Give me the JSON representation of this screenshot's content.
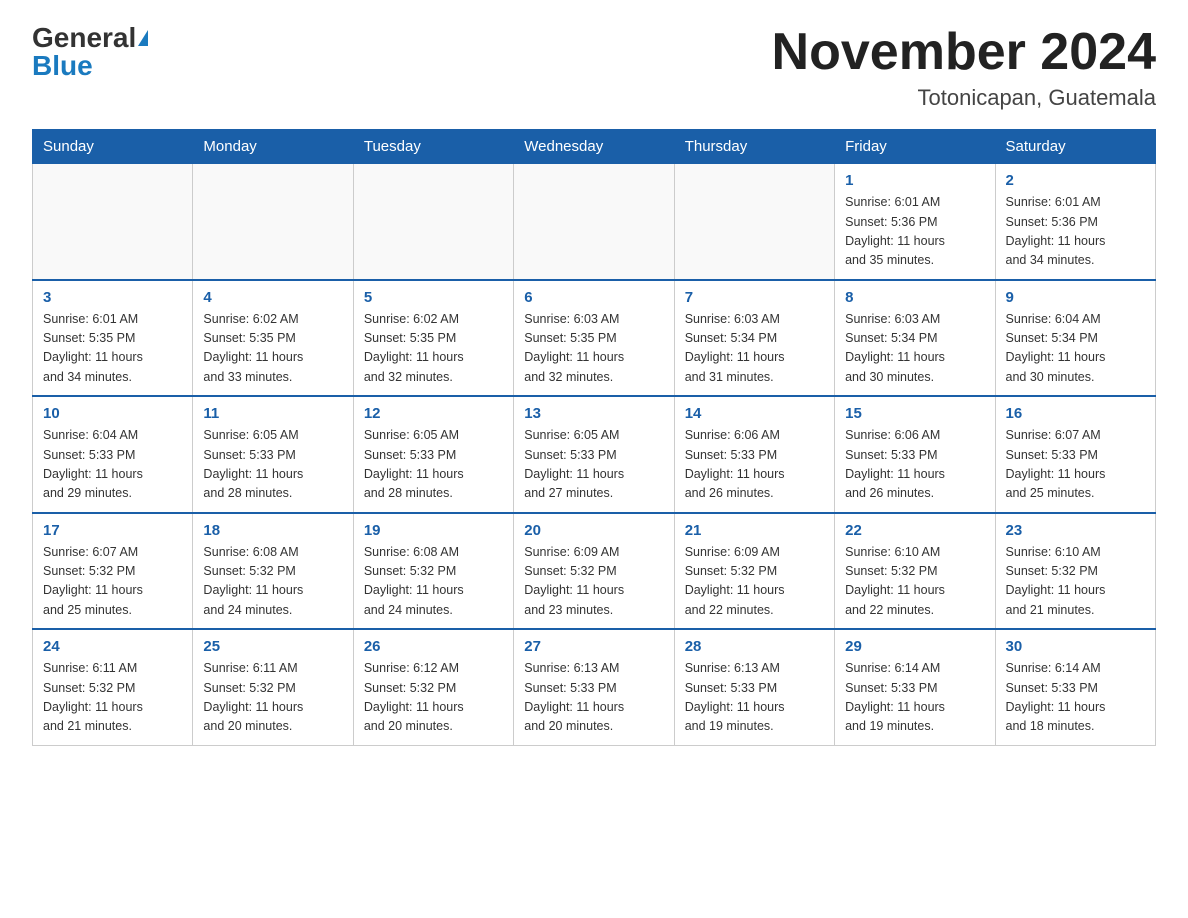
{
  "header": {
    "logo_general": "General",
    "logo_blue": "Blue",
    "month_title": "November 2024",
    "location": "Totonicapan, Guatemala"
  },
  "days_of_week": [
    "Sunday",
    "Monday",
    "Tuesday",
    "Wednesday",
    "Thursday",
    "Friday",
    "Saturday"
  ],
  "weeks": [
    [
      {
        "day": "",
        "info": ""
      },
      {
        "day": "",
        "info": ""
      },
      {
        "day": "",
        "info": ""
      },
      {
        "day": "",
        "info": ""
      },
      {
        "day": "",
        "info": ""
      },
      {
        "day": "1",
        "info": "Sunrise: 6:01 AM\nSunset: 5:36 PM\nDaylight: 11 hours\nand 35 minutes."
      },
      {
        "day": "2",
        "info": "Sunrise: 6:01 AM\nSunset: 5:36 PM\nDaylight: 11 hours\nand 34 minutes."
      }
    ],
    [
      {
        "day": "3",
        "info": "Sunrise: 6:01 AM\nSunset: 5:35 PM\nDaylight: 11 hours\nand 34 minutes."
      },
      {
        "day": "4",
        "info": "Sunrise: 6:02 AM\nSunset: 5:35 PM\nDaylight: 11 hours\nand 33 minutes."
      },
      {
        "day": "5",
        "info": "Sunrise: 6:02 AM\nSunset: 5:35 PM\nDaylight: 11 hours\nand 32 minutes."
      },
      {
        "day": "6",
        "info": "Sunrise: 6:03 AM\nSunset: 5:35 PM\nDaylight: 11 hours\nand 32 minutes."
      },
      {
        "day": "7",
        "info": "Sunrise: 6:03 AM\nSunset: 5:34 PM\nDaylight: 11 hours\nand 31 minutes."
      },
      {
        "day": "8",
        "info": "Sunrise: 6:03 AM\nSunset: 5:34 PM\nDaylight: 11 hours\nand 30 minutes."
      },
      {
        "day": "9",
        "info": "Sunrise: 6:04 AM\nSunset: 5:34 PM\nDaylight: 11 hours\nand 30 minutes."
      }
    ],
    [
      {
        "day": "10",
        "info": "Sunrise: 6:04 AM\nSunset: 5:33 PM\nDaylight: 11 hours\nand 29 minutes."
      },
      {
        "day": "11",
        "info": "Sunrise: 6:05 AM\nSunset: 5:33 PM\nDaylight: 11 hours\nand 28 minutes."
      },
      {
        "day": "12",
        "info": "Sunrise: 6:05 AM\nSunset: 5:33 PM\nDaylight: 11 hours\nand 28 minutes."
      },
      {
        "day": "13",
        "info": "Sunrise: 6:05 AM\nSunset: 5:33 PM\nDaylight: 11 hours\nand 27 minutes."
      },
      {
        "day": "14",
        "info": "Sunrise: 6:06 AM\nSunset: 5:33 PM\nDaylight: 11 hours\nand 26 minutes."
      },
      {
        "day": "15",
        "info": "Sunrise: 6:06 AM\nSunset: 5:33 PM\nDaylight: 11 hours\nand 26 minutes."
      },
      {
        "day": "16",
        "info": "Sunrise: 6:07 AM\nSunset: 5:33 PM\nDaylight: 11 hours\nand 25 minutes."
      }
    ],
    [
      {
        "day": "17",
        "info": "Sunrise: 6:07 AM\nSunset: 5:32 PM\nDaylight: 11 hours\nand 25 minutes."
      },
      {
        "day": "18",
        "info": "Sunrise: 6:08 AM\nSunset: 5:32 PM\nDaylight: 11 hours\nand 24 minutes."
      },
      {
        "day": "19",
        "info": "Sunrise: 6:08 AM\nSunset: 5:32 PM\nDaylight: 11 hours\nand 24 minutes."
      },
      {
        "day": "20",
        "info": "Sunrise: 6:09 AM\nSunset: 5:32 PM\nDaylight: 11 hours\nand 23 minutes."
      },
      {
        "day": "21",
        "info": "Sunrise: 6:09 AM\nSunset: 5:32 PM\nDaylight: 11 hours\nand 22 minutes."
      },
      {
        "day": "22",
        "info": "Sunrise: 6:10 AM\nSunset: 5:32 PM\nDaylight: 11 hours\nand 22 minutes."
      },
      {
        "day": "23",
        "info": "Sunrise: 6:10 AM\nSunset: 5:32 PM\nDaylight: 11 hours\nand 21 minutes."
      }
    ],
    [
      {
        "day": "24",
        "info": "Sunrise: 6:11 AM\nSunset: 5:32 PM\nDaylight: 11 hours\nand 21 minutes."
      },
      {
        "day": "25",
        "info": "Sunrise: 6:11 AM\nSunset: 5:32 PM\nDaylight: 11 hours\nand 20 minutes."
      },
      {
        "day": "26",
        "info": "Sunrise: 6:12 AM\nSunset: 5:32 PM\nDaylight: 11 hours\nand 20 minutes."
      },
      {
        "day": "27",
        "info": "Sunrise: 6:13 AM\nSunset: 5:33 PM\nDaylight: 11 hours\nand 20 minutes."
      },
      {
        "day": "28",
        "info": "Sunrise: 6:13 AM\nSunset: 5:33 PM\nDaylight: 11 hours\nand 19 minutes."
      },
      {
        "day": "29",
        "info": "Sunrise: 6:14 AM\nSunset: 5:33 PM\nDaylight: 11 hours\nand 19 minutes."
      },
      {
        "day": "30",
        "info": "Sunrise: 6:14 AM\nSunset: 5:33 PM\nDaylight: 11 hours\nand 18 minutes."
      }
    ]
  ]
}
